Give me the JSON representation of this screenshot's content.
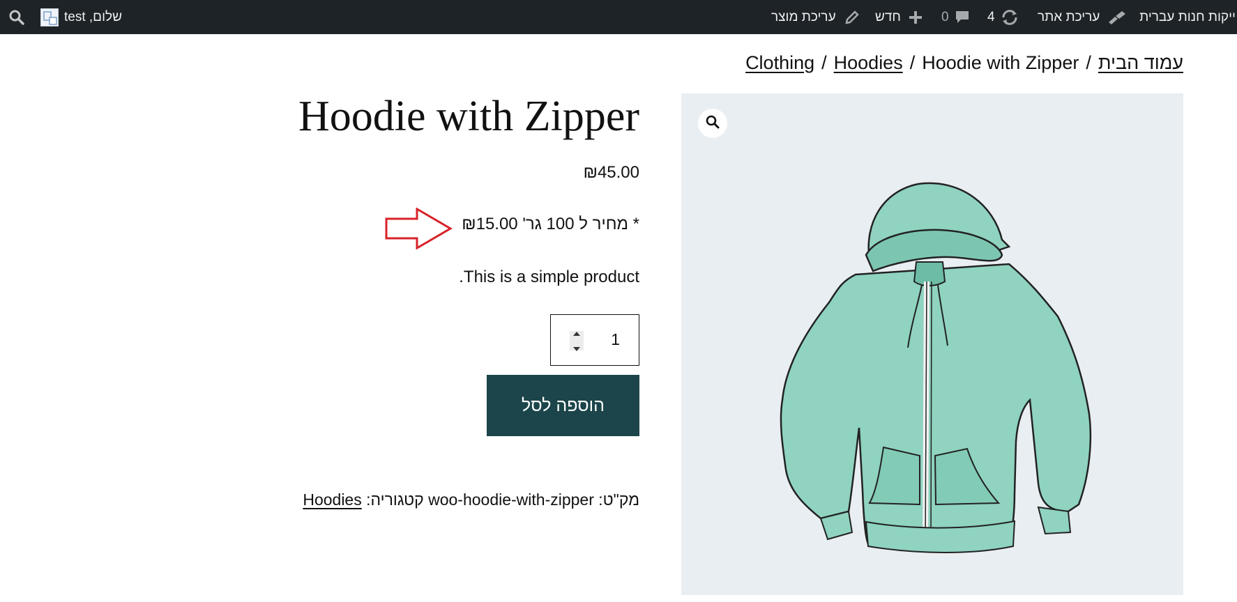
{
  "adminbar": {
    "site_name": "ייקות חנות עברית",
    "customize": "עריכת אתר",
    "updates_count": "4",
    "comments_count": "0",
    "new": "חדש",
    "edit_product": "עריכת מוצר",
    "greeting": "שלום, test"
  },
  "breadcrumb": {
    "home": "עמוד הבית",
    "sep": "/",
    "clothing": "Clothing",
    "hoodies": "Hoodies",
    "current": "Hoodie with Zipper"
  },
  "product": {
    "title": "Hoodie with Zipper",
    "price": "₪45.00",
    "unit_price_label": "* מחיר ל 100 גר' ",
    "unit_price_value": "₪15.00",
    "short_description": "This is a simple product.",
    "quantity": "1",
    "add_to_cart": "הוספה לסל",
    "sku_label": "מק\"ט:",
    "sku_value": "woo-hoodie-with-zipper",
    "category_label": "קטגוריה:",
    "category_value": "Hoodies"
  },
  "colors": {
    "admin_bar": "#1d2327",
    "button": "#1b454a",
    "gallery_bg": "#e9eef2",
    "hoodie": "#8fd3c0",
    "arrow": "#d8232a"
  },
  "icons": [
    "wordpress-brush-icon",
    "updates-icon",
    "comment-icon",
    "plus-icon",
    "pencil-icon",
    "search-icon",
    "avatar",
    "zoom-icon",
    "arrow-icon"
  ]
}
